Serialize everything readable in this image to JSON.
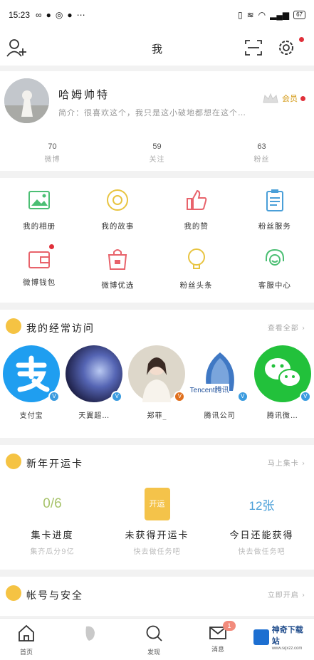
{
  "status_bar": {
    "time": "15:23",
    "right_icons": [
      "vibrate-icon",
      "wifi-icon",
      "headphone-icon",
      "signal-icon"
    ],
    "battery": "67"
  },
  "header": {
    "title": "我"
  },
  "profile": {
    "username": "哈姆帅特",
    "bio": "简介：很喜欢这个，我只是这小破地都想在这个…",
    "vip_label": "会员",
    "stats": [
      {
        "num": "70",
        "label": "微博"
      },
      {
        "num": "59",
        "label": "关注"
      },
      {
        "num": "63",
        "label": "粉丝"
      }
    ]
  },
  "grid": [
    {
      "label": "我的相册",
      "icon": "photo-icon",
      "color": "#4cbf74"
    },
    {
      "label": "我的故事",
      "icon": "story-icon",
      "color": "#e8c440"
    },
    {
      "label": "我的赞",
      "icon": "thumbs-up-icon",
      "color": "#e8636b"
    },
    {
      "label": "粉丝服务",
      "icon": "clipboard-icon",
      "color": "#4a9fd8"
    },
    {
      "label": "微博钱包",
      "icon": "wallet-icon",
      "color": "#e8636b"
    },
    {
      "label": "微博优选",
      "icon": "shopping-bag-icon",
      "color": "#e8636b"
    },
    {
      "label": "粉丝头条",
      "icon": "bulb-icon",
      "color": "#e8c440"
    },
    {
      "label": "客服中心",
      "icon": "headset-icon",
      "color": "#4cbf74"
    }
  ],
  "visits": {
    "title": "我的经常访问",
    "more": "查看全部",
    "items": [
      {
        "label": "支付宝",
        "badge": "V"
      },
      {
        "label": "天翼超…",
        "badge": "V"
      },
      {
        "label": "郑菲_",
        "badge": "V"
      },
      {
        "label": "腾讯公司",
        "badge": "V"
      },
      {
        "label": "腾讯微…",
        "badge": "V"
      }
    ],
    "tencent_text": "Tencent腾讯"
  },
  "newyear": {
    "title": "新年开运卡",
    "more": "马上集卡",
    "items": [
      {
        "figure": "0/6",
        "title": "集卡进度",
        "sub": "集齐瓜分9亿"
      },
      {
        "figure": "开运",
        "title": "未获得开运卡",
        "sub": "快去做任务吧"
      },
      {
        "figure": "12张",
        "title": "今日还能获得",
        "sub": "快去做任务吧"
      }
    ]
  },
  "security": {
    "title": "帐号与安全",
    "more": "立即开启"
  },
  "tabbar": {
    "items": [
      {
        "label": "首页"
      },
      {
        "label": ""
      },
      {
        "label": "发现"
      },
      {
        "label": "消息",
        "badge": "1"
      }
    ]
  },
  "watermark": {
    "name": "神奇下载站",
    "url": "www.sqxzz.com"
  }
}
